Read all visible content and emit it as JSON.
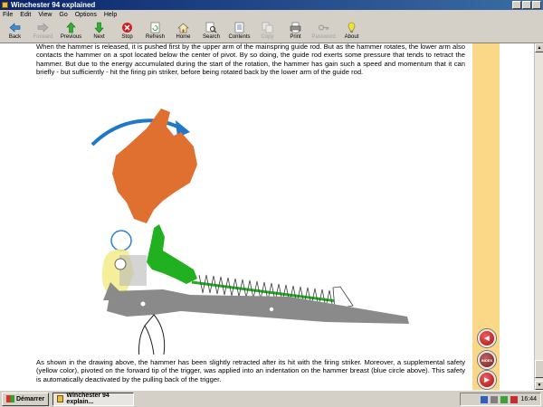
{
  "window": {
    "title": "Winchester 94 explained"
  },
  "menu": [
    "File",
    "Edit",
    "View",
    "Go",
    "Options",
    "Help"
  ],
  "toolbar": [
    {
      "label": "Back",
      "icon": "back-arrow-icon",
      "enabled": true
    },
    {
      "label": "Forward",
      "icon": "forward-arrow-icon",
      "enabled": false
    },
    {
      "label": "Previous",
      "icon": "previous-icon",
      "enabled": true
    },
    {
      "label": "Next",
      "icon": "next-icon",
      "enabled": true
    },
    {
      "label": "Stop",
      "icon": "stop-icon",
      "enabled": true
    },
    {
      "label": "Refresh",
      "icon": "refresh-icon",
      "enabled": true
    },
    {
      "label": "Home",
      "icon": "home-icon",
      "enabled": true
    },
    {
      "label": "Search",
      "icon": "search-icon",
      "enabled": true
    },
    {
      "label": "Contents",
      "icon": "contents-icon",
      "enabled": true
    },
    {
      "label": "Copy",
      "icon": "copy-icon",
      "enabled": false
    },
    {
      "label": "Print",
      "icon": "print-icon",
      "enabled": true
    },
    {
      "label": "Password",
      "icon": "password-icon",
      "enabled": false
    },
    {
      "label": "About",
      "icon": "about-icon",
      "enabled": true
    }
  ],
  "content": {
    "para1": "When the hammer is released, it is pushed first by the upper arm of the mainspring guide rod. But as the hammer rotates, the lower arm also contacts the hammer on a spot located below the center of pivot. By so doing, the guide rod exerts some pressure that tends to retract the hammer. But due to the energy accumulated during the start of the rotation, the hammer has gain such a speed and momentum that it can briefly - but sufficiently - hit the firing pin striker, before being rotated back by the lower arm of the guide rod.",
    "para2": "As shown in the drawing above, the hammer has been slightly retracted after its hit with the firing striker. Moreover, a supplemental safety (yellow color), pivoted on the forward tip of the trigger, was applied into an indentation on the hammer breast (blue circle above). This safety is automatically deactivated by the pulling back of the trigger."
  },
  "nav_buttons": [
    {
      "name": "previous-page-button",
      "label": "◀"
    },
    {
      "name": "index-button",
      "label": "INDEX"
    },
    {
      "name": "next-page-button",
      "label": "▶"
    }
  ],
  "colors": {
    "hammer": "#e07030",
    "guide_rod": "#20b020",
    "frame": "#8a8a8a",
    "safety": "#f0e060",
    "arrow": "#1f78c8",
    "side_strip": "#fbd888"
  },
  "taskbar": {
    "start_label": "Démarrer",
    "task_label": "Winchester 94 explain...",
    "clock": "16:44"
  }
}
